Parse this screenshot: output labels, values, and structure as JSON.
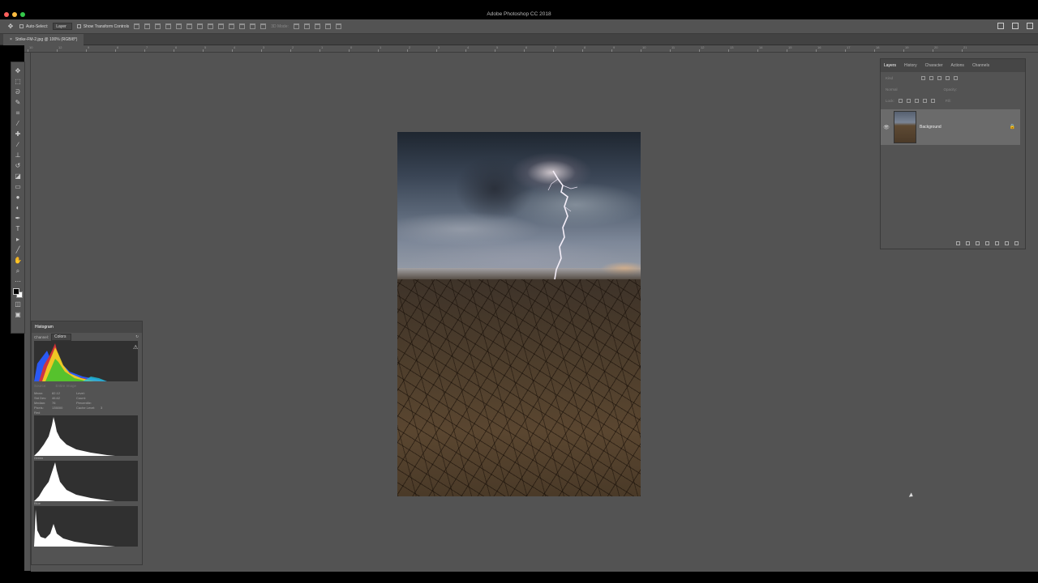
{
  "window": {
    "title": "Adobe Photoshop CC 2018"
  },
  "options_bar": {
    "auto_select_label": "Auto-Select:",
    "auto_select_value": "Layer",
    "show_transform_label": "Show Transform Controls",
    "mode_3d_label": "3D Mode:"
  },
  "document_tab": {
    "label": "Strike-FM-2.jpg @ 100% (RGB/8*)",
    "close": "×"
  },
  "ruler": {
    "top_ticks": [
      "10",
      "12",
      "9",
      "8",
      "7",
      "6",
      "5",
      "4",
      "3",
      "2",
      "1",
      "0",
      "1",
      "2",
      "3",
      "4",
      "5",
      "6",
      "7",
      "8",
      "9",
      "10",
      "11",
      "12",
      "13",
      "14",
      "15",
      "16",
      "17",
      "18",
      "19",
      "20",
      "21"
    ]
  },
  "layers_panel": {
    "tabs": [
      "Layers",
      "History",
      "Character",
      "Actions",
      "Channels"
    ],
    "kind_label": "Kind",
    "normal_label": "Normal",
    "opacity_label": "Opacity:",
    "lock_label": "Lock:",
    "fill_label": "Fill:",
    "layer_name": "Background"
  },
  "histogram_panel": {
    "title": "Histogram",
    "channel_label": "Channel:",
    "channel_value": "Colors",
    "source_label": "Source:",
    "source_value": "Entire Image",
    "stats": [
      [
        "Mean:",
        "82.12",
        "Level:",
        ""
      ],
      [
        "Std Dev:",
        "46.62",
        "Count:",
        ""
      ],
      [
        "Median:",
        "76",
        "Percentile:",
        ""
      ],
      [
        "Pixels:",
        "135000",
        "Cache Level:",
        "3"
      ]
    ],
    "channels": [
      "Red",
      "Green",
      "Blue"
    ]
  },
  "colors": {
    "ui_bg": "#535353",
    "panel_dark": "#464646",
    "selected_layer": "#6b6b6b"
  }
}
